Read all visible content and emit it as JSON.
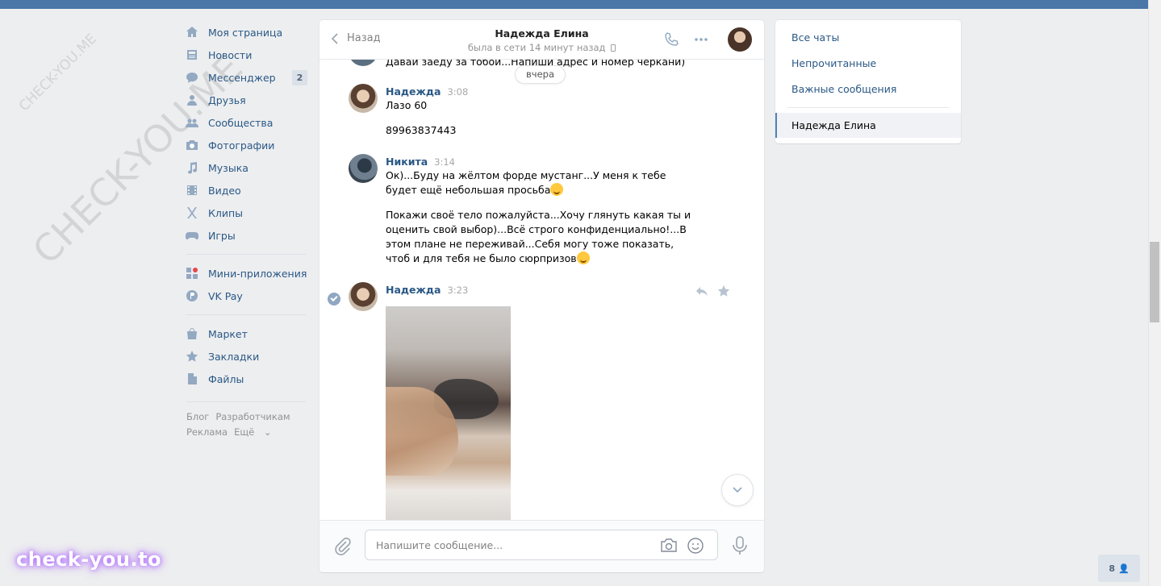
{
  "nav": {
    "items": [
      {
        "label": "Моя страница",
        "icon": "home-icon"
      },
      {
        "label": "Новости",
        "icon": "news-icon"
      },
      {
        "label": "Мессенджер",
        "icon": "messenger-icon",
        "badge": "2"
      },
      {
        "label": "Друзья",
        "icon": "friends-icon"
      },
      {
        "label": "Сообщества",
        "icon": "communities-icon"
      },
      {
        "label": "Фотографии",
        "icon": "camera-icon"
      },
      {
        "label": "Музыка",
        "icon": "music-icon"
      },
      {
        "label": "Видео",
        "icon": "video-icon"
      },
      {
        "label": "Клипы",
        "icon": "clips-icon"
      },
      {
        "label": "Игры",
        "icon": "gamepad-icon"
      }
    ],
    "items2": [
      {
        "label": "Мини-приложения",
        "icon": "apps-icon"
      },
      {
        "label": "VK Pay",
        "icon": "vkpay-icon"
      }
    ],
    "items3": [
      {
        "label": "Маркет",
        "icon": "bag-icon"
      },
      {
        "label": "Закладки",
        "icon": "star-icon"
      },
      {
        "label": "Файлы",
        "icon": "file-icon"
      }
    ],
    "footer": {
      "blog": "Блог",
      "dev": "Разработчикам",
      "ads": "Реклама",
      "more": "Ещё"
    }
  },
  "watermark": {
    "text": "CHECK-YOU.ME"
  },
  "chat": {
    "back_label": "Назад",
    "peer_name": "Надежда Елина",
    "peer_status": "была в сети 14 минут назад",
    "date_divider": "вчера",
    "top_message": "Давай заеду за тобой...Напиши адрес и номер черкани)",
    "messages": [
      {
        "author": "Надежда",
        "time": "3:08",
        "lines": [
          "Лазо 60",
          "89963837443"
        ]
      },
      {
        "author": "Никита",
        "time": "3:14",
        "p1": "Ок)...Буду на жёлтом форде мустанг...У меня к тебе будет ещё небольшая просьба",
        "p2": "Покажи своё тело пожалуйста...Хочу глянуть какая ты и оценить свой выбор)...Всё строго конфиденциально!...В этом плане не переживай...Себя могу тоже показать, чтоб и для тебя не было сюрпризов"
      },
      {
        "author": "Надежда",
        "time": "3:23"
      }
    ],
    "input_placeholder": "Напишите сообщение..."
  },
  "right": {
    "all_chats": "Все чаты",
    "unread": "Непрочитанные",
    "important": "Важные сообщения",
    "active_chat": "Надежда Елина"
  },
  "brand": "check-you.to",
  "online_count": "8",
  "colors": {
    "topbar": "#4a76a8",
    "link": "#2a5885",
    "bg": "#edeef0"
  }
}
